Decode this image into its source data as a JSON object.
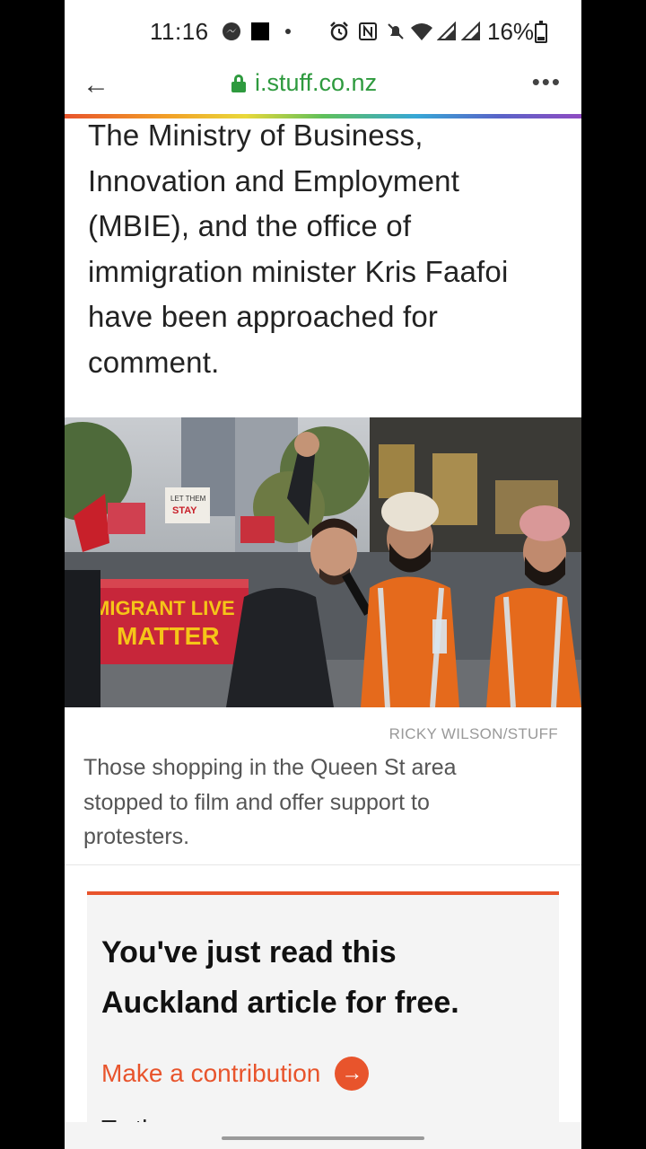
{
  "status_bar": {
    "time": "11:16",
    "battery": "16%",
    "icons": [
      "messenger-icon",
      "square-icon",
      "dot-icon",
      "alarm-icon",
      "nfc-icon",
      "mute-icon",
      "wifi-icon",
      "signal-icon",
      "signal-icon",
      "battery-icon"
    ]
  },
  "browser": {
    "back_label": "←",
    "url": "i.stuff.co.nz",
    "menu_label": "•••"
  },
  "article": {
    "paragraph": "The Ministry of Business, Innovation and Employment (MBIE), and the office of immigration minister Kris Faafoi have been approached for comment.",
    "photo": {
      "banner_line1": "MIGRANT LIVE",
      "banner_line2": "MATTER",
      "sign_text": "LET THEM STAY"
    },
    "photo_credit": "RICKY WILSON/STUFF",
    "caption": "Those shopping in the Queen St area stopped to film and offer support to protesters."
  },
  "contribution": {
    "heading": "You've just read this Auckland article for free.",
    "cta_label": "Make a contribution",
    "cta_icon": "→",
    "cutoff_text": "To    th"
  },
  "colors": {
    "accent": "#e8542c",
    "url_green": "#2e9a3e"
  }
}
